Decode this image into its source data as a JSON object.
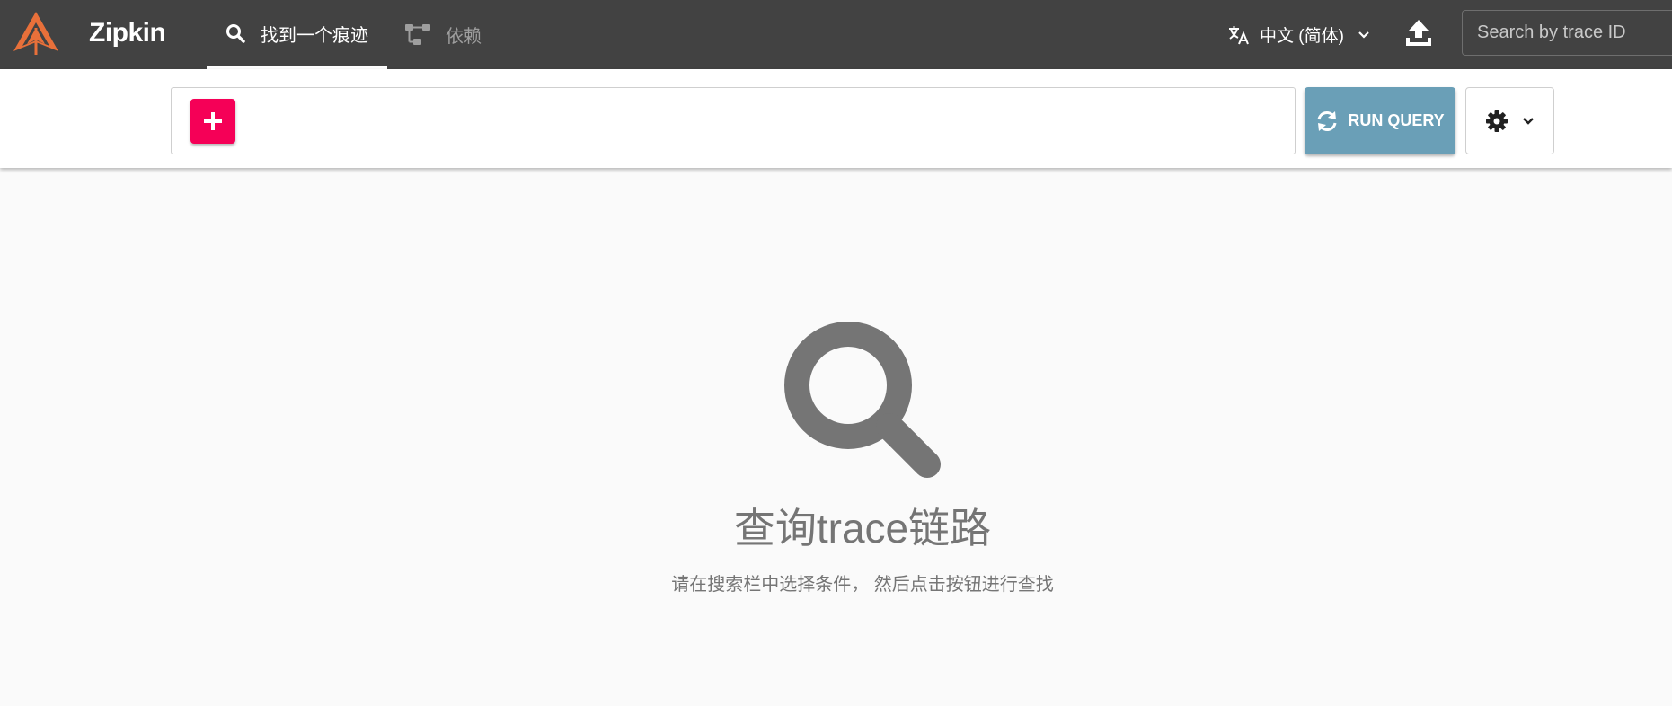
{
  "app": {
    "brand": "Zipkin",
    "brand_color": "#e8703a"
  },
  "nav": {
    "tabs": [
      {
        "label": "找到一个痕迹",
        "icon": "search-icon",
        "active": true
      },
      {
        "label": "依赖",
        "icon": "dependency-graph-icon",
        "active": false
      }
    ]
  },
  "header": {
    "language": "中文 (简体)",
    "language_icon": "translate-icon",
    "upload_icon": "upload-icon",
    "trace_search_placeholder": "Search by trace ID"
  },
  "query": {
    "add_icon": "plus-icon",
    "add_button_color": "#f50057",
    "run_label": "RUN QUERY",
    "run_icon": "sync-icon",
    "run_button_color": "#6a9fb7",
    "settings_icon": "gear-icon"
  },
  "empty_state": {
    "icon": "search-icon",
    "title": "查询trace链路",
    "hint": "请在搜索栏中选择条件， 然后点击按钮进行查找"
  }
}
